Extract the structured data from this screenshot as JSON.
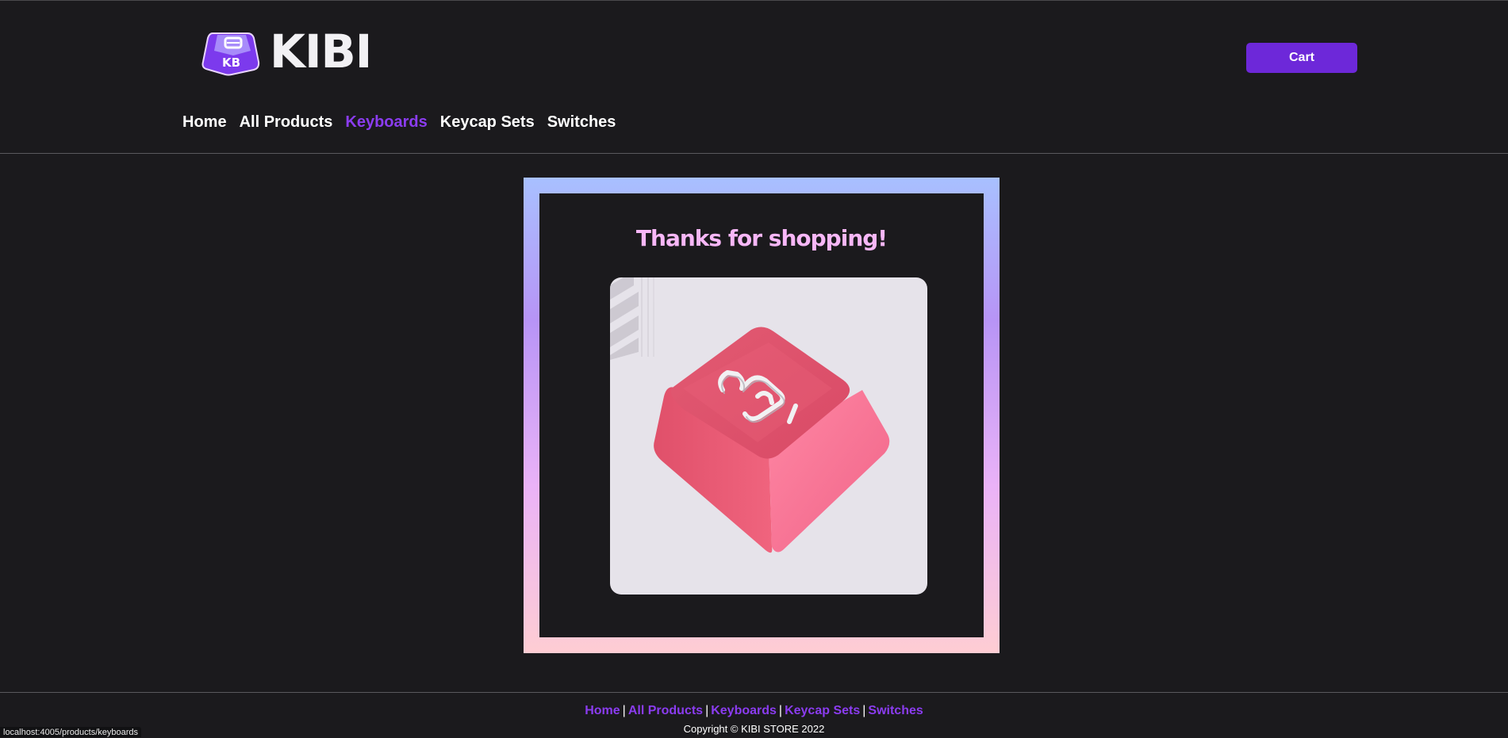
{
  "brand": {
    "name": "KIBI",
    "icon_letters": "KB",
    "accent_color": "#6d28d9",
    "link_color": "#8b3cf0"
  },
  "header": {
    "cart_label": "Cart",
    "nav": [
      {
        "label": "Home",
        "active": false
      },
      {
        "label": "All Products",
        "active": false
      },
      {
        "label": "Keyboards",
        "active": true
      },
      {
        "label": "Keycap Sets",
        "active": false
      },
      {
        "label": "Switches",
        "active": false
      }
    ]
  },
  "main": {
    "heading": "Thanks for shopping!",
    "image_icon": "pink-keycap-image"
  },
  "footer": {
    "links": [
      {
        "label": "Home"
      },
      {
        "label": "All Products"
      },
      {
        "label": "Keyboards"
      },
      {
        "label": "Keycap Sets"
      },
      {
        "label": "Switches"
      }
    ],
    "separator": "|",
    "copyright": "Copyright © KIBI STORE 2022"
  },
  "status_bar": {
    "url": "localhost:4005/products/keyboards"
  }
}
